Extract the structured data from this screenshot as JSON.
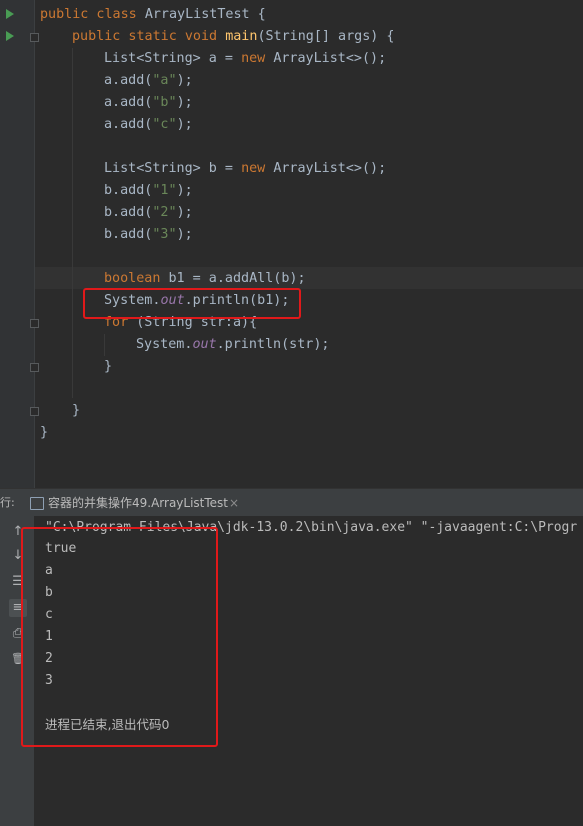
{
  "code": {
    "l1": {
      "kw": "public class ",
      "name": "ArrayListTest",
      "rest": " {"
    },
    "l2": {
      "kw": "public static void ",
      "fn": "main",
      "rest": "(String[] args) {"
    },
    "l3": {
      "a": "List<String> a = ",
      "kw": "new ",
      "b": "ArrayList<>();"
    },
    "l4": {
      "a": "a.add(",
      "s": "\"a\"",
      "b": ");"
    },
    "l5": {
      "a": "a.add(",
      "s": "\"b\"",
      "b": ");"
    },
    "l6": {
      "a": "a.add(",
      "s": "\"c\"",
      "b": ");"
    },
    "l7": {
      "a": "List<String> b = ",
      "kw": "new ",
      "b": "ArrayList<>();"
    },
    "l8": {
      "a": "b.add(",
      "s": "\"1\"",
      "b": ");"
    },
    "l9": {
      "a": "b.add(",
      "s": "\"2\"",
      "b": ");"
    },
    "l10": {
      "a": "b.add(",
      "s": "\"3\"",
      "b": ");"
    },
    "l11": {
      "kw": "boolean ",
      "rest": "b1 = a.addAll(b);"
    },
    "l12": {
      "a": "System.",
      "field": "out",
      "b": ".println(b1);"
    },
    "l13": {
      "kw": "for ",
      "rest": "(String str:a){"
    },
    "l14": {
      "a": "System.",
      "field": "out",
      "b": ".println(str);"
    },
    "l15": "}",
    "l16": "}",
    "l17": "}"
  },
  "run_panel": {
    "prefix": "行:",
    "tab_title": "容器的并集操作49.ArrayListTest",
    "tab_close": "×",
    "side": {
      "up": "↑",
      "down": "↓",
      "wrap": "☰",
      "scroll": "≡",
      "print": "⎙",
      "trash": "🗑"
    }
  },
  "console": {
    "command": "\"C:\\Program Files\\Java\\jdk-13.0.2\\bin\\java.exe\" \"-javaagent:C:\\Progr",
    "lines": [
      "true",
      "a",
      "b",
      "c",
      "1",
      "2",
      "3"
    ],
    "exit_message": "进程已结束,退出代码0"
  },
  "colors": {
    "highlight_box": "#e0191a",
    "keyword": "#cc7832",
    "method": "#ffc66d",
    "string": "#6a8759",
    "field": "#9876aa"
  }
}
